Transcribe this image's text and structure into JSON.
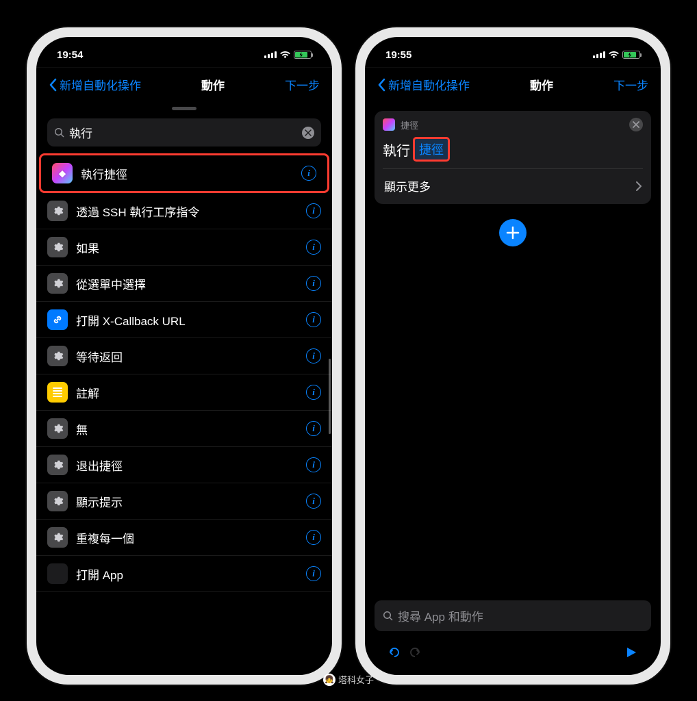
{
  "left": {
    "status_time": "19:54",
    "nav": {
      "back": "新增自動化操作",
      "title": "動作",
      "next": "下一步"
    },
    "search": {
      "value": "執行"
    },
    "actions": [
      {
        "label": "執行捷徑",
        "icon": "shortcuts",
        "highlight": true
      },
      {
        "label": "透過 SSH 執行工序指令",
        "icon": "gear"
      },
      {
        "label": "如果",
        "icon": "gear"
      },
      {
        "label": "從選單中選擇",
        "icon": "gear"
      },
      {
        "label": "打開 X-Callback URL",
        "icon": "link"
      },
      {
        "label": "等待返回",
        "icon": "gear"
      },
      {
        "label": "註解",
        "icon": "note"
      },
      {
        "label": "無",
        "icon": "gear"
      },
      {
        "label": "退出捷徑",
        "icon": "gear"
      },
      {
        "label": "顯示提示",
        "icon": "gear"
      },
      {
        "label": "重複每一個",
        "icon": "gear"
      },
      {
        "label": "打開 App",
        "icon": "grid"
      }
    ]
  },
  "right": {
    "status_time": "19:55",
    "nav": {
      "back": "新增自動化操作",
      "title": "動作",
      "next": "下一步"
    },
    "card": {
      "app_label": "捷徑",
      "run_text": "執行",
      "token": "捷徑",
      "more": "顯示更多"
    },
    "search_placeholder": "搜尋 App 和動作"
  },
  "watermark": "塔科女子"
}
